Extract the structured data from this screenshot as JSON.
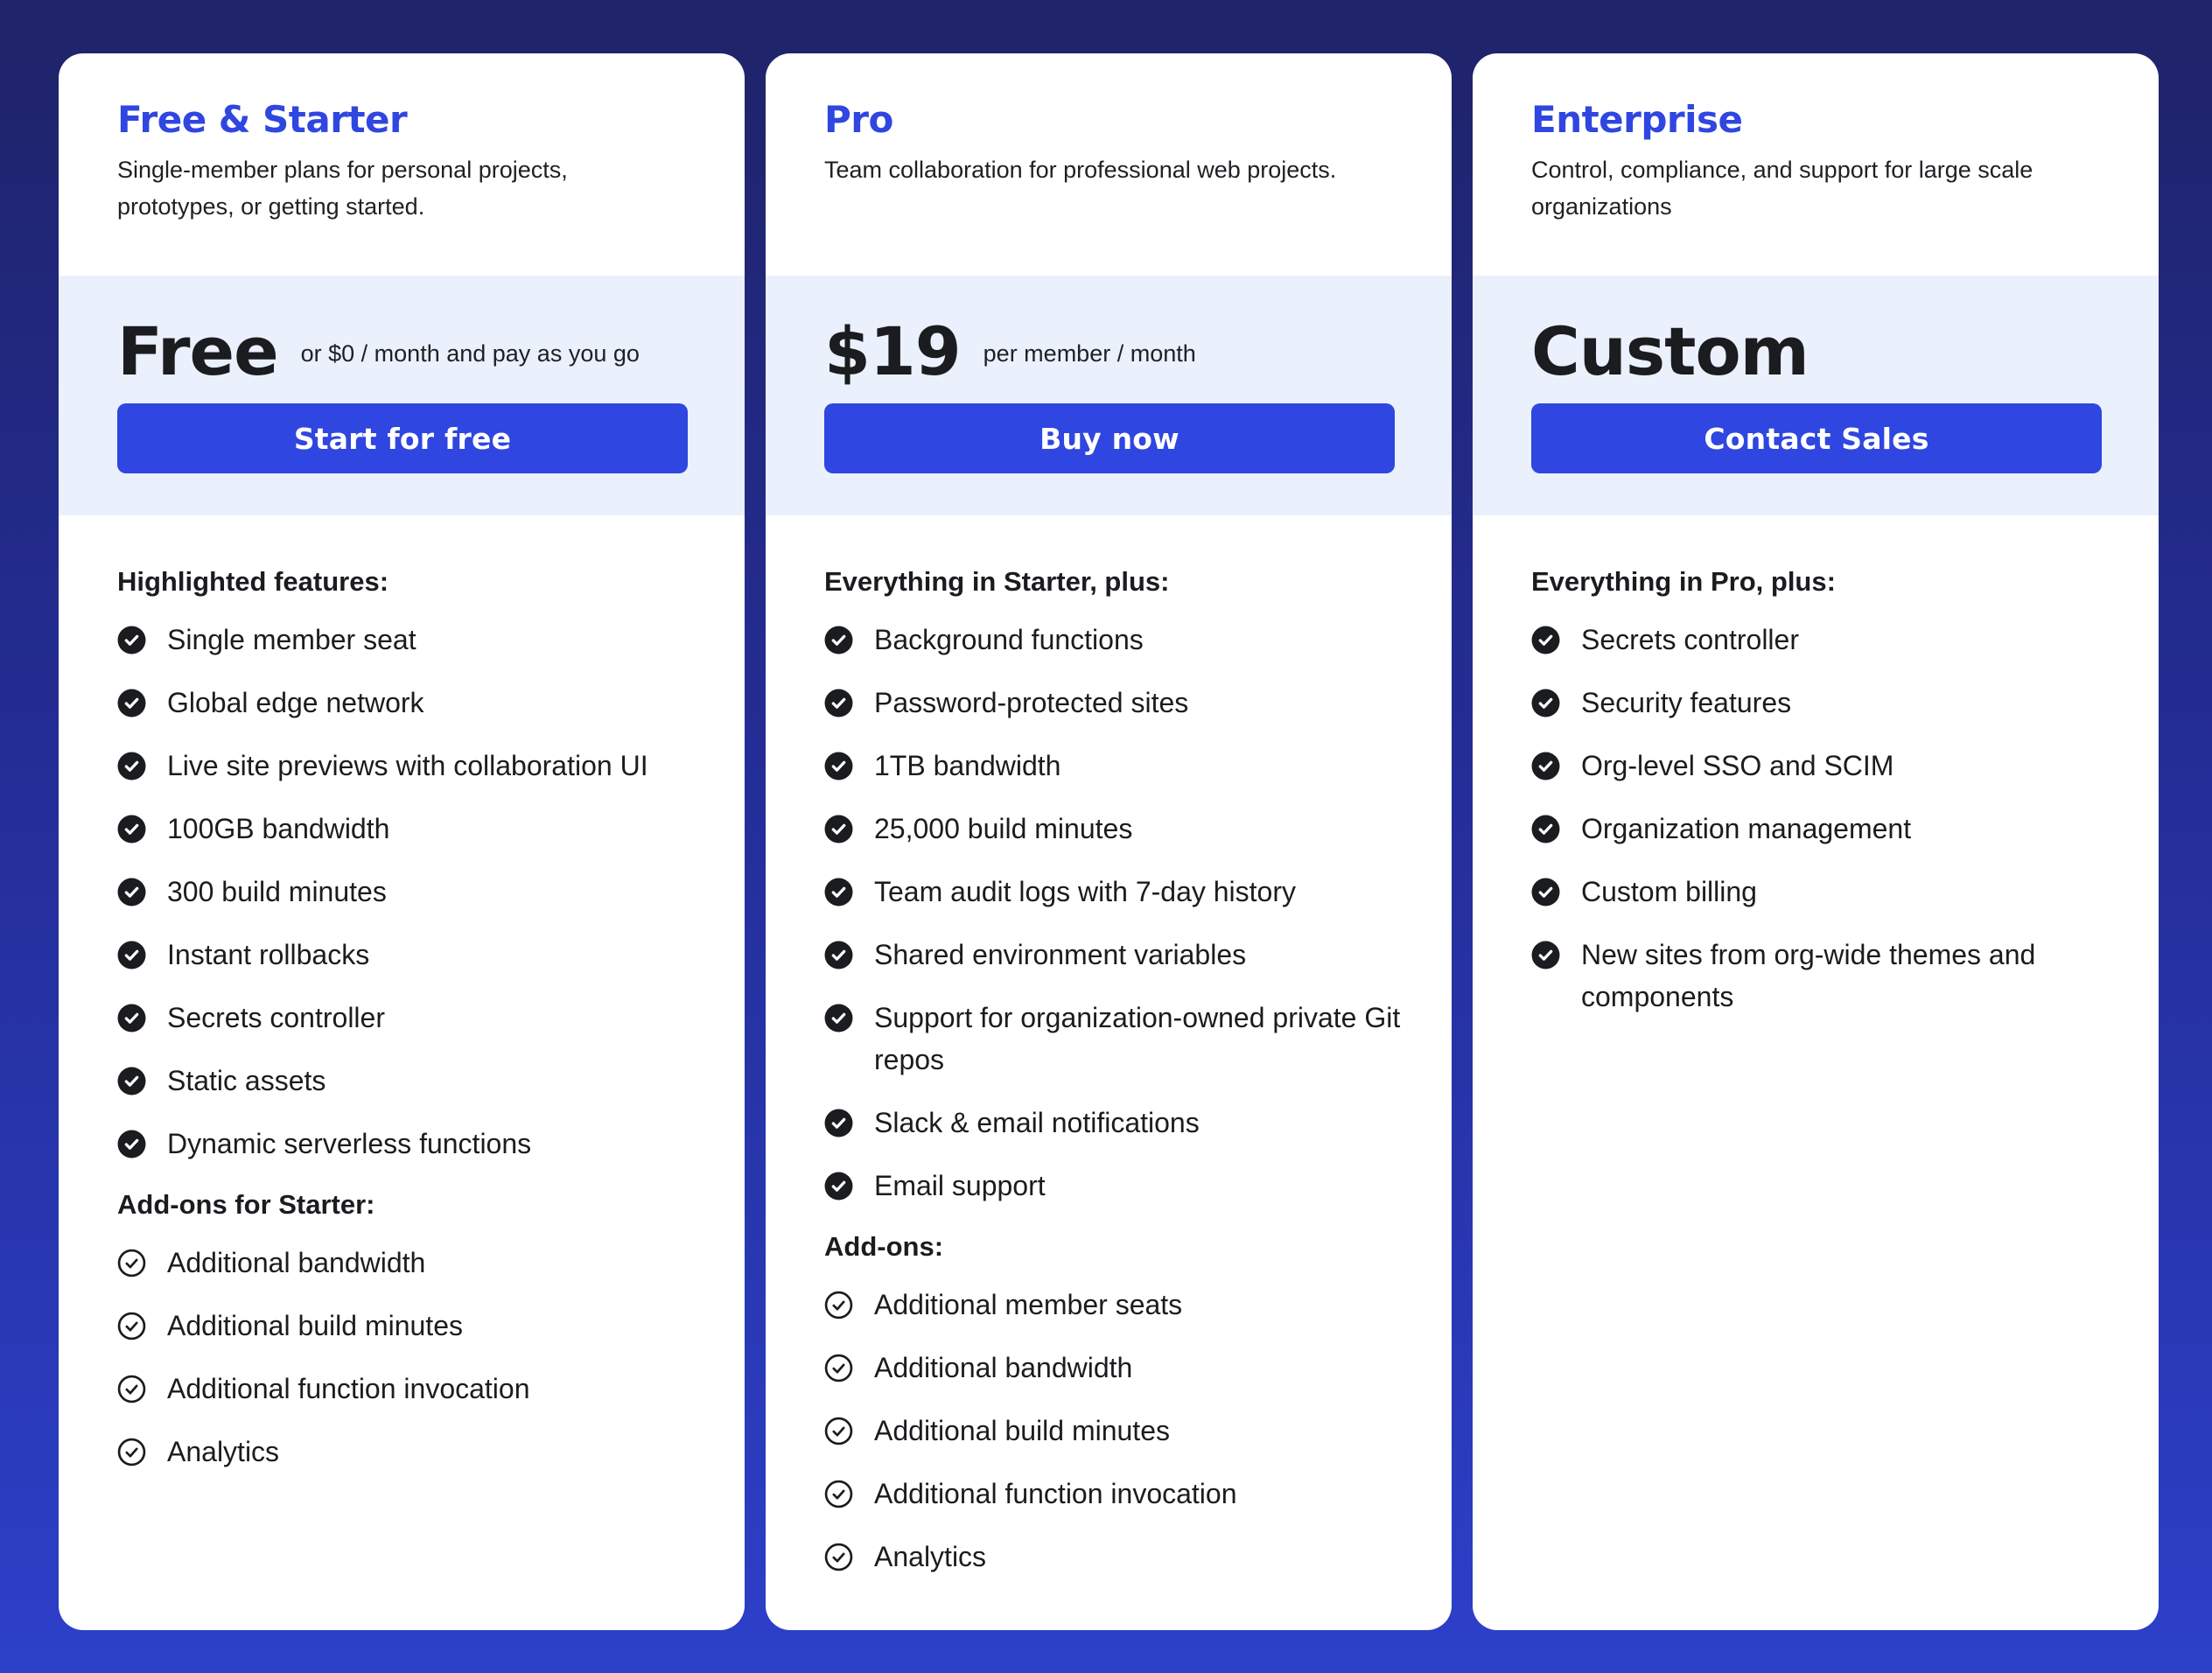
{
  "colors": {
    "accent": "#2f46e0",
    "price_band": "#eaf0fc",
    "text": "#1b1c1f",
    "bg_top": "#1f2368",
    "bg_bottom": "#2c40c9"
  },
  "plans": [
    {
      "title": "Free & Starter",
      "description": "Single-member plans for personal projects, prototypes, or getting started.",
      "price": "Free",
      "price_note": "or $0 / month and pay as you go",
      "cta_label": "Start for free",
      "sections": [
        {
          "heading": "Highlighted features:",
          "icon": "check-circle-filled",
          "items": [
            "Single member seat",
            "Global edge network",
            "Live site previews with collaboration UI",
            "100GB bandwidth",
            "300 build minutes",
            "Instant rollbacks",
            "Secrets controller",
            "Static assets",
            "Dynamic serverless functions"
          ]
        },
        {
          "heading": "Add-ons for Starter:",
          "icon": "check-circle-outline",
          "items": [
            "Additional bandwidth",
            "Additional build minutes",
            "Additional function invocation",
            "Analytics"
          ]
        }
      ]
    },
    {
      "title": "Pro",
      "description": "Team collaboration for professional web projects.",
      "price": "$19",
      "price_note": "per member / month",
      "cta_label": "Buy now",
      "sections": [
        {
          "heading": "Everything in Starter, plus:",
          "icon": "check-circle-filled",
          "items": [
            "Background functions",
            "Password-protected sites",
            "1TB bandwidth",
            "25,000 build minutes",
            "Team audit logs with 7-day history",
            "Shared environment variables",
            "Support for organization-owned private Git repos",
            "Slack & email notifications",
            "Email support"
          ]
        },
        {
          "heading": "Add-ons:",
          "icon": "check-circle-outline",
          "items": [
            "Additional member seats",
            "Additional bandwidth",
            "Additional build minutes",
            "Additional function invocation",
            "Analytics"
          ]
        }
      ]
    },
    {
      "title": "Enterprise",
      "description": "Control, compliance, and support for large scale organizations",
      "price": "Custom",
      "price_note": "",
      "cta_label": "Contact Sales",
      "sections": [
        {
          "heading": "Everything in Pro, plus:",
          "icon": "check-circle-filled",
          "items": [
            "Secrets controller",
            "Security features",
            "Org-level SSO and SCIM",
            "Organization management",
            "Custom billing",
            "New sites from org-wide themes and components"
          ]
        }
      ]
    }
  ]
}
